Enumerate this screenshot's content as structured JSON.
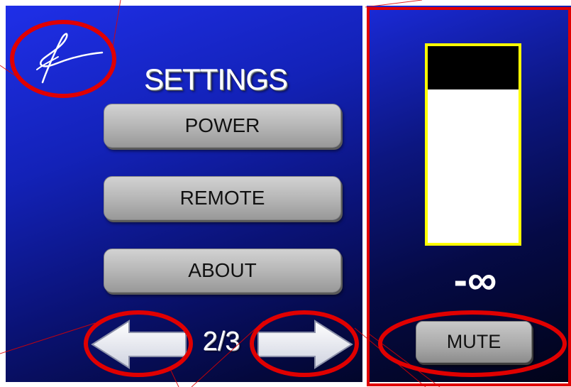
{
  "screen": {
    "title": "SETTINGS",
    "logo_icon": "signature-logo-icon"
  },
  "menu": {
    "items": [
      {
        "label": "POWER"
      },
      {
        "label": "REMOTE"
      },
      {
        "label": "ABOUT"
      }
    ]
  },
  "pagination": {
    "indicator": "2/3",
    "prev_icon": "arrow-left-icon",
    "next_icon": "arrow-right-icon"
  },
  "volume": {
    "level": 0.22,
    "level_text": "-∞",
    "mute_label": "MUTE"
  },
  "colors": {
    "annotation": "#e00000",
    "meter_border": "#ffff00",
    "panel_blue": "#1f2fe8"
  }
}
